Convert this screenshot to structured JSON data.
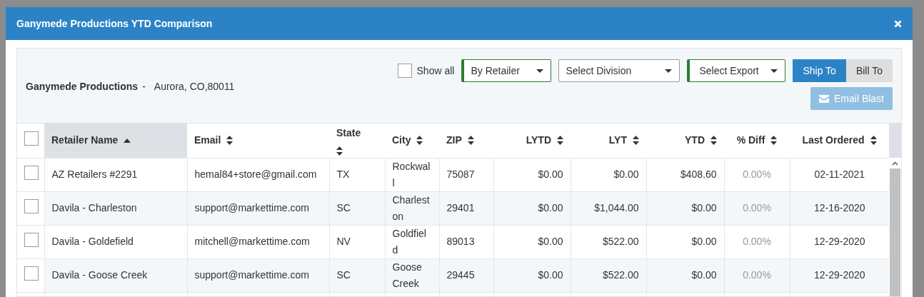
{
  "dialog": {
    "title": "Ganymede Productions YTD Comparison"
  },
  "company": {
    "name": "Ganymede Productions",
    "separator": "-",
    "address": "Aurora, CO,80011"
  },
  "toolbar": {
    "show_all": {
      "label": "Show all",
      "checked": false
    },
    "selects": [
      {
        "value": "By Retailer",
        "highlighted": true
      },
      {
        "value": "Select Division",
        "highlighted": false
      },
      {
        "value": "Select Export",
        "highlighted": true
      }
    ],
    "address_tabs": [
      {
        "label": "Ship To",
        "selected": true
      },
      {
        "label": "Bill To",
        "selected": false
      }
    ],
    "email_blast": {
      "label": "Email Blast",
      "disabled": true
    }
  },
  "table": {
    "select_all": {
      "checked": false
    },
    "columns": [
      {
        "label": "Retailer Name",
        "sorted": true
      },
      {
        "label": "Email",
        "sorted": false
      },
      {
        "label": "State",
        "sorted": false
      },
      {
        "label": "City",
        "sorted": false
      },
      {
        "label": "ZIP",
        "sorted": false
      },
      {
        "label": "LYTD",
        "sorted": false
      },
      {
        "label": "LYT",
        "sorted": false
      },
      {
        "label": "YTD",
        "sorted": false
      },
      {
        "label": "% Diff",
        "sorted": false
      },
      {
        "label": "Last Ordered",
        "sorted": false
      }
    ],
    "rows": [
      {
        "checked": false,
        "cells": [
          "AZ Retailers #2291",
          "hemal84+store@gmail.com",
          "TX",
          "Rockwall",
          "75087",
          "$0.00",
          "$0.00",
          "$408.60",
          "0.00%",
          "02-11-2021"
        ]
      },
      {
        "checked": false,
        "cells": [
          "Davila - Charleston",
          "support@markettime.com",
          "SC",
          "Charleston",
          "29401",
          "$0.00",
          "$1,044.00",
          "$0.00",
          "0.00%",
          "12-16-2020"
        ]
      },
      {
        "checked": false,
        "cells": [
          "Davila - Goldefield",
          "mitchell@markettime.com",
          "NV",
          "Goldfield",
          "89013",
          "$0.00",
          "$522.00",
          "$0.00",
          "0.00%",
          "12-29-2020"
        ]
      },
      {
        "checked": false,
        "cells": [
          "Davila - Goose Creek",
          "support@markettime.com",
          "SC",
          "Goose Creek",
          "29445",
          "$0.00",
          "$522.00",
          "$0.00",
          "0.00%",
          "12-29-2020"
        ]
      }
    ]
  }
}
